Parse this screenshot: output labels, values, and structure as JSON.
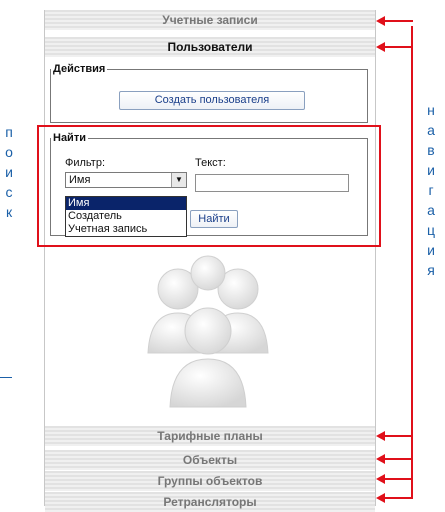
{
  "nav": {
    "top": [
      "Учетные записи",
      "Пользователи"
    ],
    "bottom": [
      "Тарифные планы",
      "Объекты",
      "Группы объектов",
      "Ретрансляторы"
    ]
  },
  "actions": {
    "legend": "Действия",
    "create_button": "Создать пользователя"
  },
  "search": {
    "legend": "Найти",
    "filter_label": "Фильтр:",
    "filter_value": "Имя",
    "text_label": "Текст:",
    "text_value": "",
    "find_button": "Найти",
    "options": [
      "Имя",
      "Создатель",
      "Учетная запись"
    ]
  },
  "annotations": {
    "left_word": "поиск",
    "right_word": "навигация"
  },
  "colors": {
    "highlight": "#e0101a",
    "annotation_text": "#1b60a8",
    "selected_option": "#0a246a"
  }
}
